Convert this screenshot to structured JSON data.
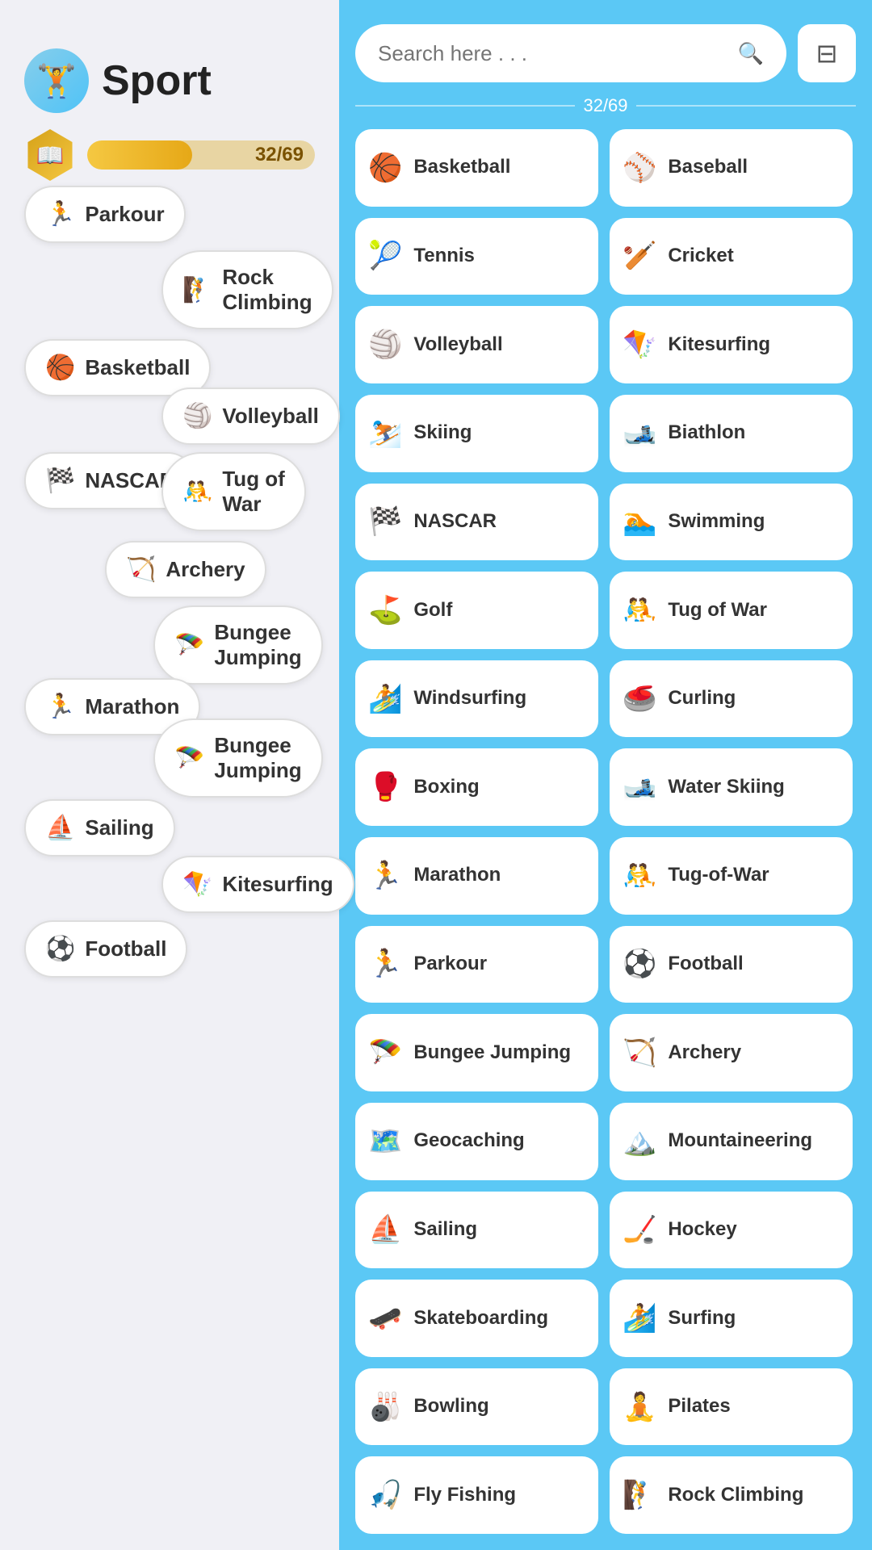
{
  "app": {
    "title": "Sport",
    "icon": "🏋️",
    "progress_current": 32,
    "progress_total": 69,
    "progress_label": "32/69",
    "progress_percent": 46
  },
  "search": {
    "placeholder": "Search here . . .",
    "progress_display": "32/69"
  },
  "left_pills": [
    {
      "id": "parkour",
      "label": "Parkour",
      "icon": "🏃"
    },
    {
      "id": "rock-climbing",
      "label": "Rock Climbing",
      "icon": "🧗"
    },
    {
      "id": "basketball",
      "label": "Basketball",
      "icon": "🏀"
    },
    {
      "id": "volleyball",
      "label": "Volleyball",
      "icon": "🏐"
    },
    {
      "id": "nascar",
      "label": "NASCAR",
      "icon": "🏁"
    },
    {
      "id": "tug-of-war",
      "label": "Tug of War",
      "icon": "🤼"
    },
    {
      "id": "archery",
      "label": "Archery",
      "icon": "🏹"
    },
    {
      "id": "bungee-jumping-1",
      "label": "Bungee Jumping",
      "icon": "🪂"
    },
    {
      "id": "marathon",
      "label": "Marathon",
      "icon": "🏃"
    },
    {
      "id": "bungee-jumping-2",
      "label": "Bungee Jumping",
      "icon": "🪂"
    },
    {
      "id": "sailing",
      "label": "Sailing",
      "icon": "⛵"
    },
    {
      "id": "kitesurfing",
      "label": "Kitesurfing",
      "icon": "🪁"
    },
    {
      "id": "football",
      "label": "Football",
      "icon": "⚽"
    }
  ],
  "grid_sports": [
    {
      "id": "basketball",
      "label": "Basketball",
      "icon": "🏀"
    },
    {
      "id": "baseball",
      "label": "Baseball",
      "icon": "⚾"
    },
    {
      "id": "tennis",
      "label": "Tennis",
      "icon": "🎾"
    },
    {
      "id": "cricket",
      "label": "Cricket",
      "icon": "🏏"
    },
    {
      "id": "volleyball",
      "label": "Volleyball",
      "icon": "🏐"
    },
    {
      "id": "kitesurfing",
      "label": "Kitesurfing",
      "icon": "🪁"
    },
    {
      "id": "skiing",
      "label": "Skiing",
      "icon": "⛷️"
    },
    {
      "id": "biathlon",
      "label": "Biathlon",
      "icon": "🎿"
    },
    {
      "id": "nascar",
      "label": "NASCAR",
      "icon": "🏁"
    },
    {
      "id": "swimming",
      "label": "Swimming",
      "icon": "🏊"
    },
    {
      "id": "golf",
      "label": "Golf",
      "icon": "⛳"
    },
    {
      "id": "tug-of-war",
      "label": "Tug of War",
      "icon": "🤼"
    },
    {
      "id": "windsurfing",
      "label": "Windsurfing",
      "icon": "🏄"
    },
    {
      "id": "curling",
      "label": "Curling",
      "icon": "🥌"
    },
    {
      "id": "boxing",
      "label": "Boxing",
      "icon": "🥊"
    },
    {
      "id": "water-skiing",
      "label": "Water Skiing",
      "icon": "🎿"
    },
    {
      "id": "marathon",
      "label": "Marathon",
      "icon": "🏃"
    },
    {
      "id": "tug-of-war-2",
      "label": "Tug-of-War",
      "icon": "🤼"
    },
    {
      "id": "parkour",
      "label": "Parkour",
      "icon": "🏃"
    },
    {
      "id": "football",
      "label": "Football",
      "icon": "⚽"
    },
    {
      "id": "bungee-jumping",
      "label": "Bungee Jumping",
      "icon": "🪂"
    },
    {
      "id": "archery",
      "label": "Archery",
      "icon": "🏹"
    },
    {
      "id": "geocaching",
      "label": "Geocaching",
      "icon": "🗺️"
    },
    {
      "id": "mountaineering",
      "label": "Mountaineering",
      "icon": "🏔️"
    },
    {
      "id": "sailing",
      "label": "Sailing",
      "icon": "⛵"
    },
    {
      "id": "hockey",
      "label": "Hockey",
      "icon": "🏒"
    },
    {
      "id": "skateboarding",
      "label": "Skateboarding",
      "icon": "🛹"
    },
    {
      "id": "surfing",
      "label": "Surfing",
      "icon": "🏄"
    },
    {
      "id": "bowling",
      "label": "Bowling",
      "icon": "🎳"
    },
    {
      "id": "pilates",
      "label": "Pilates",
      "icon": "🧘"
    },
    {
      "id": "fly-fishing",
      "label": "Fly Fishing",
      "icon": "🎣"
    },
    {
      "id": "rock-climbing",
      "label": "Rock Climbing",
      "icon": "🧗"
    }
  ],
  "filter_icon": "▼",
  "search_icon": "🔍"
}
